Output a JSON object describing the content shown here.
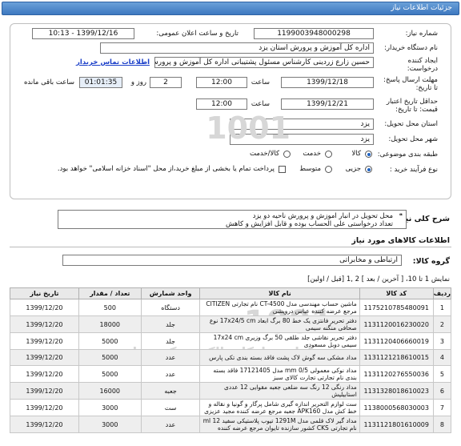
{
  "header": {
    "title": "جزئیات اطلاعات نیاز"
  },
  "form": {
    "need_number_label": "شماره نیاز:",
    "need_number": "1199003948000298",
    "announce_label": "تاریخ و ساعت اعلان عمومی:",
    "announce_value": "1399/12/16 - 10:13",
    "buyer_label": "نام دستگاه خریدار:",
    "buyer_value": "اداره کل آموزش و پرورش استان یزد",
    "creator_label": "ایجاد کننده درخواست:",
    "creator_value": "حسین زارع زردینی  کارشناس مسئول پشتیبانی  اداره کل آموزش و پرورش استان",
    "contact_link": "اطلاعات تماس خریدار",
    "deadline_label": "مهلت ارسال پاسخ: تا تاریخ:",
    "deadline_date": "1399/12/18",
    "time_label": "ساعت",
    "deadline_time": "12:00",
    "days_value": "2",
    "days_label": "روز و",
    "countdown": "01:01:35",
    "remaining_label": "ساعت باقی مانده",
    "price_validity_label": "حداقل تاریخ اعتبار قیمت: تا تاریخ:",
    "price_date": "1399/12/21",
    "price_time": "12:00",
    "province_label": "استان محل تحویل:",
    "province_value": "یزد",
    "city_label": "شهر محل تحویل:",
    "city_value": "یزد",
    "category_label": "طبقه بندی موضوعی:",
    "category_options": [
      "کالا",
      "خدمت",
      "کالا/خدمت"
    ],
    "category_selected": 0,
    "purchase_label": "نوع فرآیند خرید :",
    "purchase_options": [
      "جزیی",
      "متوسط"
    ],
    "purchase_selected": 0,
    "payment_text": "پرداخت تمام یا بخشی از مبلغ خرید،از محل \"اسناد خزانه اسلامی\" خواهد بود."
  },
  "description": {
    "label": "شرح کلی نیاز:",
    "line1": "محل تحویل در انبار اموزش و پرورش ناحیه دو یزد",
    "line2": "تعداد درخواستی علی الحساب بوده و قابل افزایش و کاهش"
  },
  "goods": {
    "section_title": "اطلاعات کالاهای مورد نیاز",
    "group_label": "گروه کالا:",
    "group_value": "ارتباطی و مخابراتی",
    "pagination": "نمایش 1 تا 10، [ آخرین / بعد ] 2 ,1 [قبل / اولین]",
    "columns": [
      "ردیف",
      "کد کالا",
      "نام کالا",
      "واحد شمارش",
      "تعداد / مقدار",
      "تاریخ نیاز"
    ],
    "rows": [
      {
        "n": "1",
        "code": "1175210785480091",
        "name": "ماشین حساب مهندسی مدل CT-4500 نام تجارتی CITIZEN مرجع عرضه کننده عباس درویشی",
        "unit": "دستگاه",
        "qty": "500",
        "date": "1399/12/20"
      },
      {
        "n": "2",
        "code": "1131120016230020",
        "name": "دفتر تحریر فانتزی یک خط 80 برگ ابعاد 17x24/5 cm نوع صحافی منگنه سیمی",
        "unit": "جلد",
        "qty": "18000",
        "date": "1399/12/20"
      },
      {
        "n": "3",
        "code": "1131120406660019",
        "name": "دفتر تحریر نقاشی جلد طلقی 50 برگ وزیری 17x24 cm سیمی دوبل مسعودی",
        "unit": "جلد",
        "qty": "5000",
        "date": "1399/12/20"
      },
      {
        "n": "4",
        "code": "1131121218610015",
        "name": "مداد مشکی سه گوش لاک پشت فاقد بسته بندی تکی پارس",
        "unit": "عدد",
        "qty": "5000",
        "date": "1399/12/20"
      },
      {
        "n": "5",
        "code": "1131120276550036",
        "name": "مداد نوکی معمولی mm 0/5 مدل 17121405 فاقد بسته بندی نام تجارتی تجارت کالای سبز",
        "unit": "عدد",
        "qty": "5000",
        "date": "1399/12/20"
      },
      {
        "n": "6",
        "code": "1131328018610023",
        "name": "مداد رنگی 12 رنگ سه ضلعی جعبه مقوایی 12 عددی استابیلیش",
        "unit": "جعبه",
        "qty": "16000",
        "date": "1399/12/20"
      },
      {
        "n": "7",
        "code": "1138000568030003",
        "name": "ست لوازم التحریر اندازه گیری شامل پرگار و گونیا و نقاله و خط کش مدل APK160 جعبه مرجع عرضه کننده مجید عزیزی",
        "unit": "ست",
        "qty": "3000",
        "date": "1399/12/20"
      },
      {
        "n": "8",
        "code": "1131121801610009",
        "name": "مداد گیر لاک قلمی مدل 1291M تیوب پلاستیکی سفید 12 ml نام تجارتی CKS کشور سازنده تایوان مرجع عرضه کننده",
        "unit": "عدد",
        "qty": "3000",
        "date": "1399/12/20"
      }
    ]
  },
  "watermark": {
    "line1": "1001",
    "line2": "سامانه تدارکات الکترونیکی دولت"
  }
}
